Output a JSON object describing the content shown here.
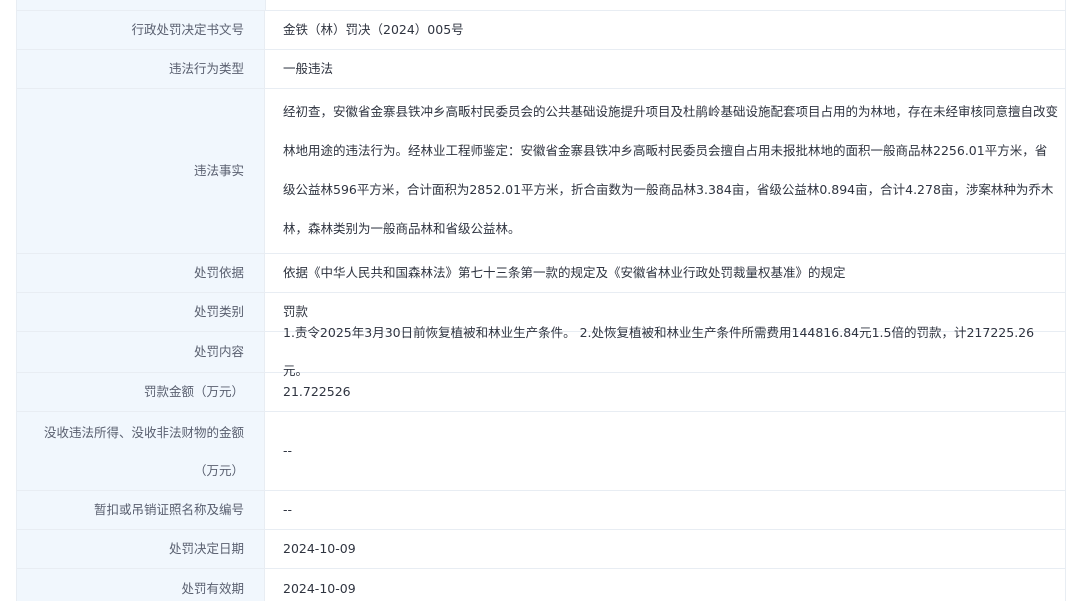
{
  "rows": [
    {
      "label": "行政处罚决定书文号",
      "value": "金铁（林）罚决（2024）005号"
    },
    {
      "label": "违法行为类型",
      "value": "一般违法"
    },
    {
      "label": "违法事实",
      "value": "经初查，安徽省金寨县铁冲乡高畈村民委员会的公共基础设施提升项目及杜鹃岭基础设施配套项目占用的为林地，存在未经审核同意擅自改变林地用途的违法行为。经林业工程师鉴定：安徽省金寨县铁冲乡高畈村民委员会擅自占用未报批林地的面积一般商品林2256.01平方米，省级公益林596平方米，合计面积为2852.01平方米，折合亩数为一般商品林3.384亩，省级公益林0.894亩，合计4.278亩，涉案林种为乔木林，森林类别为一般商品林和省级公益林。"
    },
    {
      "label": "处罚依据",
      "value": "依据《中华人民共和国森林法》第七十三条第一款的规定及《安徽省林业行政处罚裁量权基准》的规定"
    },
    {
      "label": "处罚类别",
      "value": "罚款"
    },
    {
      "label": "处罚内容",
      "value": "1.责令2025年3月30日前恢复植被和林业生产条件。 2.处恢复植被和林业生产条件所需费用144816.84元1.5倍的罚款，计217225.26元。"
    },
    {
      "label": "罚款金额（万元）",
      "value": "21.722526"
    },
    {
      "label_line1": "没收违法所得、没收非法财物的金额",
      "label_line2": "（万元）",
      "value": "--"
    },
    {
      "label": "暂扣或吊销证照名称及编号",
      "value": "--"
    },
    {
      "label": "处罚决定日期",
      "value": "2024-10-09"
    },
    {
      "label": "处罚有效期",
      "value": "2024-10-09"
    }
  ]
}
